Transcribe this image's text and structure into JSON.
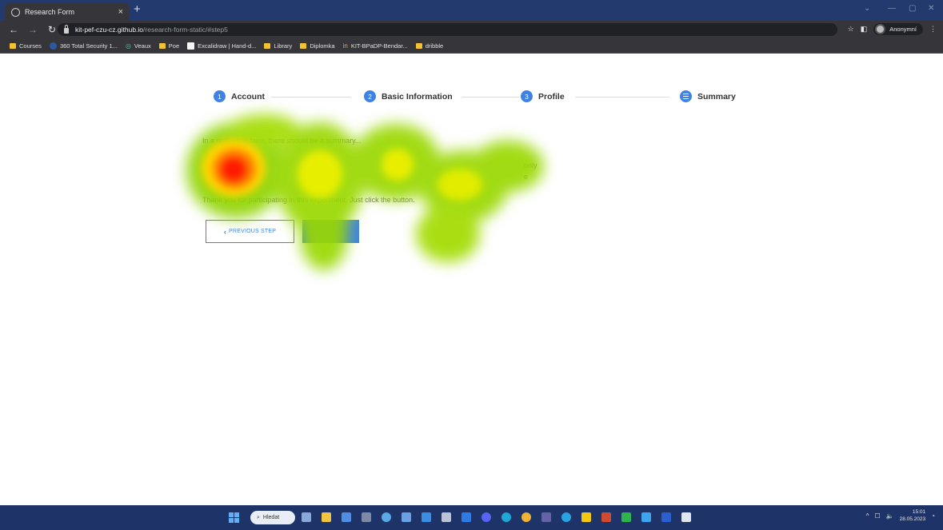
{
  "browser": {
    "tab_title": "Research Form",
    "tab_close": "×",
    "new_tab": "+",
    "url_host": "kit-pef-czu-cz.github.io",
    "url_path": "/research-form-static/#step5",
    "profile_label": "Anonymní",
    "icons": [
      "back-icon",
      "forward-icon",
      "reload-icon",
      "lock-icon",
      "star-icon",
      "sidepanel-icon",
      "menu-icon"
    ],
    "bookmarks": [
      {
        "label": "Courses",
        "icon": "folder"
      },
      {
        "label": "360 Total Security 1...",
        "icon": "wordpress"
      },
      {
        "label": "Veaux",
        "icon": "veaux"
      },
      {
        "label": "Poe",
        "icon": "folder"
      },
      {
        "label": "Excalidraw | Hand-d...",
        "icon": "excalidraw"
      },
      {
        "label": "Library",
        "icon": "folder"
      },
      {
        "label": "Diplomka",
        "icon": "folder"
      },
      {
        "label": "KIT-BPaDP-Bendar...",
        "icon": "link"
      },
      {
        "label": "dribble",
        "icon": "folder"
      }
    ]
  },
  "wizard": {
    "steps": [
      {
        "num": "1",
        "label": "Account"
      },
      {
        "num": "2",
        "label": "Basic Information"
      },
      {
        "num": "3",
        "label": "Profile"
      },
      {
        "num": "",
        "label": "Summary",
        "icon": "list-icon"
      }
    ],
    "paragraphs": [
      "In a real-world form, there should be a summary...",
      "only",
      "e",
      "Thank you for participating in this experiment. Just click the button."
    ],
    "prev_label": "PREVIOUS STEP",
    "prev_icon": "‹",
    "next_label": ""
  },
  "taskbar": {
    "search_label": "Hledat",
    "time": "15:01",
    "date": "28.05.2023",
    "accent": "#1e3368"
  },
  "colors": {
    "primary": "#3f82e6",
    "chrome_dark": "#36363a",
    "tab_strip": "#233a6e"
  }
}
